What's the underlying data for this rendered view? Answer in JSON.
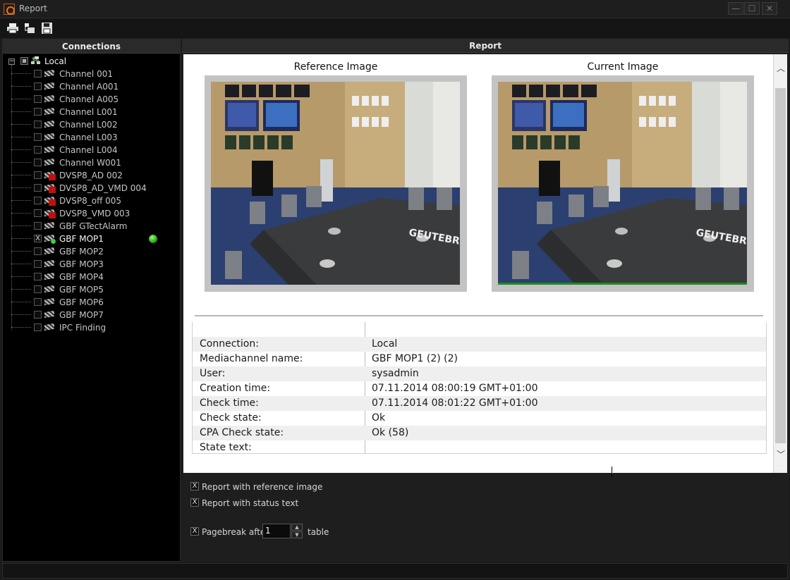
{
  "window": {
    "title": "Report",
    "minimize_glyph": "—",
    "maximize_glyph": "☐",
    "close_glyph": "✕"
  },
  "toolbar": {
    "icons": [
      "print-icon",
      "print-preview-icon",
      "save-report-icon"
    ]
  },
  "sidebar": {
    "header": "Connections",
    "root": {
      "label": "Local",
      "expander": "−"
    },
    "items": [
      {
        "label": "Channel 001",
        "icon": "camera-icon",
        "checked": false
      },
      {
        "label": "Channel A001",
        "icon": "camera-icon",
        "checked": false
      },
      {
        "label": "Channel A005",
        "icon": "camera-icon",
        "checked": false
      },
      {
        "label": "Channel L001",
        "icon": "camera-icon",
        "checked": false
      },
      {
        "label": "Channel L002",
        "icon": "camera-icon",
        "checked": false
      },
      {
        "label": "Channel L003",
        "icon": "camera-icon",
        "checked": false
      },
      {
        "label": "Channel L004",
        "icon": "camera-icon",
        "checked": false
      },
      {
        "label": "Channel W001",
        "icon": "camera-icon",
        "checked": false
      },
      {
        "label": "DVSP8_AD 002",
        "icon": "camera-vmd-icon",
        "checked": false
      },
      {
        "label": "DVSP8_AD_VMD 004",
        "icon": "camera-vmd-icon",
        "checked": false
      },
      {
        "label": "DVSP8_off 005",
        "icon": "camera-vmd-icon",
        "checked": false
      },
      {
        "label": "DVSP8_VMD 003",
        "icon": "camera-vmd-icon",
        "checked": false
      },
      {
        "label": "GBF GTectAlarm",
        "icon": "camera-icon",
        "checked": false
      },
      {
        "label": "GBF MOP1",
        "icon": "camera-ok-icon",
        "checked": true
      },
      {
        "label": "GBF MOP2",
        "icon": "camera-icon",
        "checked": false
      },
      {
        "label": "GBF MOP3",
        "icon": "camera-icon",
        "checked": false
      },
      {
        "label": "GBF MOP4",
        "icon": "camera-icon",
        "checked": false
      },
      {
        "label": "GBF MOP5",
        "icon": "camera-icon",
        "checked": false
      },
      {
        "label": "GBF MOP6",
        "icon": "camera-icon",
        "checked": false
      },
      {
        "label": "GBF MOP7",
        "icon": "camera-icon",
        "checked": false
      },
      {
        "label": "IPC Finding",
        "icon": "camera-icon",
        "checked": false
      }
    ],
    "check_mark": "X"
  },
  "report": {
    "header": "Report",
    "reference_title": "Reference Image",
    "current_title": "Current Image",
    "brand_text": "GEUTEBRUCK",
    "rows": [
      {
        "key": "Connection:",
        "value": "Local"
      },
      {
        "key": "Mediachannel name:",
        "value": "GBF MOP1 (2) (2)"
      },
      {
        "key": "User:",
        "value": "sysadmin"
      },
      {
        "key": "Creation time:",
        "value": "07.11.2014 08:00:19 GMT+01:00"
      },
      {
        "key": "Check time:",
        "value": "07.11.2014 08:01:22 GMT+01:00"
      },
      {
        "key": "Check state:",
        "value": "Ok"
      },
      {
        "key": "CPA Check state:",
        "value": "Ok (58)"
      },
      {
        "key": "State text:",
        "value": ""
      }
    ]
  },
  "options": {
    "with_reference_image": "Report with reference image",
    "with_status_text": "Report with status text",
    "pagebreak_label": "Pagebreak afte",
    "pagebreak_value": "1",
    "pagebreak_suffix": "table",
    "check_mark": "X"
  },
  "colors": {
    "accent_orange": "#e07a2a",
    "status_green": "#2aa51a"
  }
}
